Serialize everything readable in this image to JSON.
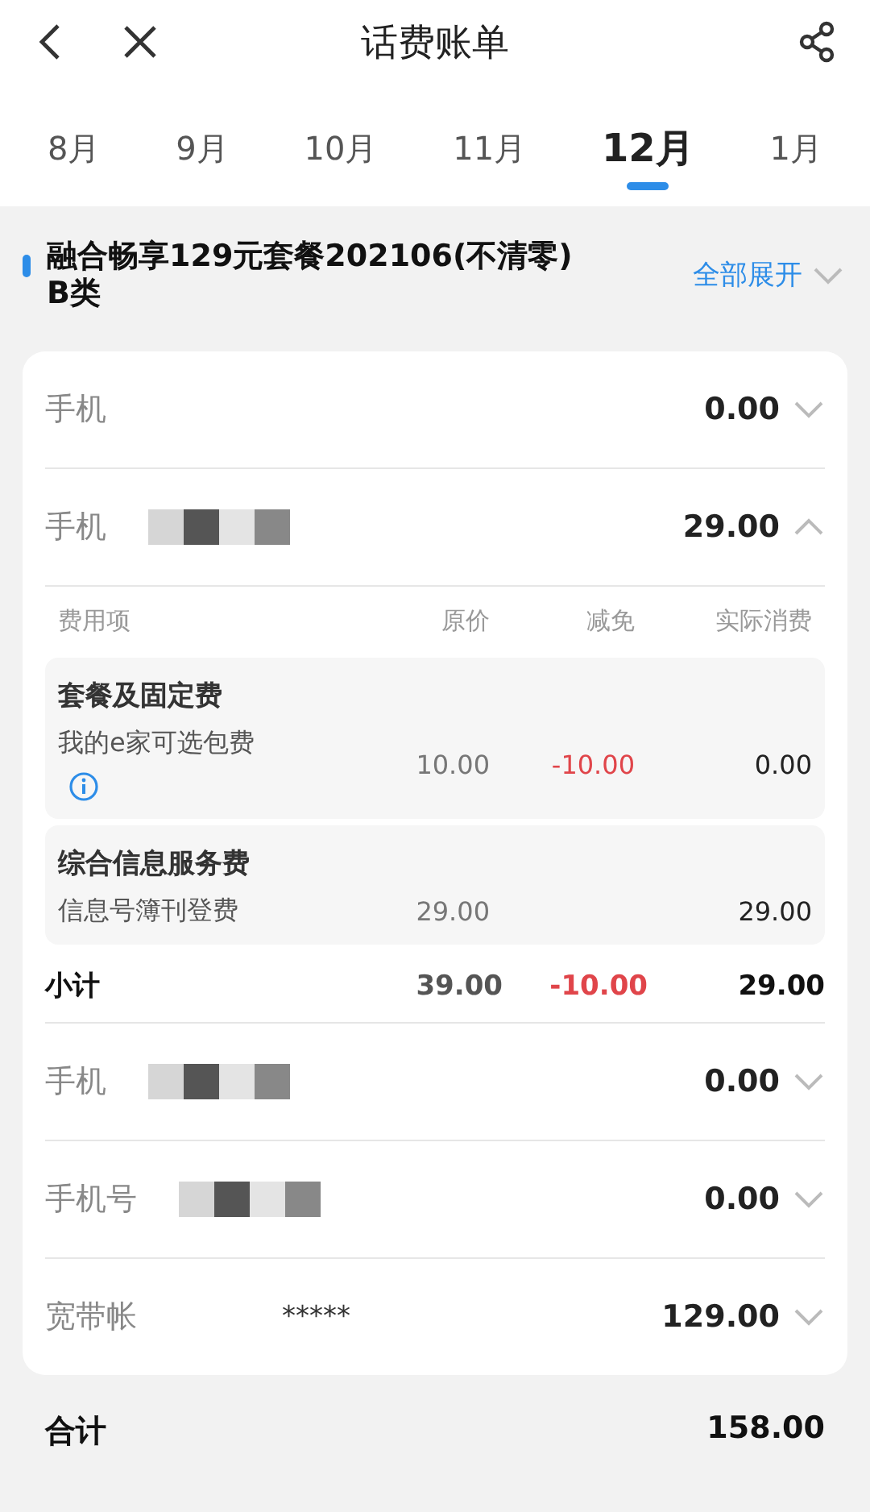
{
  "header": {
    "title": "话费账单"
  },
  "months": [
    {
      "label": "8月",
      "selected": false
    },
    {
      "label": "9月",
      "selected": false
    },
    {
      "label": "10月",
      "selected": false
    },
    {
      "label": "11月",
      "selected": false
    },
    {
      "label": "12月",
      "selected": true
    },
    {
      "label": "1月",
      "selected": false
    }
  ],
  "plan": {
    "name": "融合畅享129元套餐202106(不清零) B类",
    "expand_all": "全部展开"
  },
  "lines": [
    {
      "label": "手机",
      "amount": "0.00",
      "expanded": false,
      "masked": false
    },
    {
      "label": "手机",
      "amount": "29.00",
      "expanded": true,
      "masked": true,
      "detail": {
        "columns": [
          "费用项",
          "原价",
          "减免",
          "实际消费"
        ],
        "groups": [
          {
            "title": "套餐及固定费",
            "items": [
              {
                "name": "我的e家可选包费",
                "info": true,
                "original": "10.00",
                "discount": "-10.00",
                "actual": "0.00"
              }
            ]
          },
          {
            "title": "综合信息服务费",
            "items": [
              {
                "name": "信息号簿刊登费",
                "info": false,
                "original": "29.00",
                "actual": "29.00"
              }
            ]
          }
        ],
        "subtotal": {
          "label": "小计",
          "original": "39.00",
          "discount": "-10.00",
          "actual": "29.00"
        }
      }
    },
    {
      "label": "手机",
      "amount": "0.00",
      "expanded": false,
      "masked": true
    },
    {
      "label": "手机号",
      "amount": "0.00",
      "expanded": false,
      "masked": true
    },
    {
      "label": "宽带帐",
      "account": "*****",
      "amount": "129.00",
      "expanded": false,
      "masked": false
    }
  ],
  "total": {
    "label": "合计",
    "amount": "158.00"
  }
}
